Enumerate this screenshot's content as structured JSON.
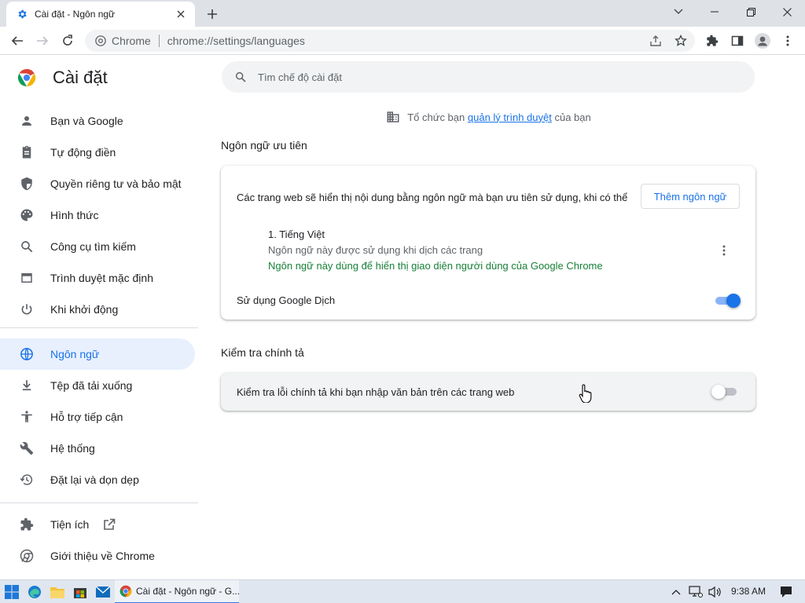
{
  "browser": {
    "tab_title": "Cài đặt - Ngôn ngữ",
    "omnibox_chip": "Chrome",
    "url": "chrome://settings/languages"
  },
  "sidebar": {
    "title": "Cài đặt",
    "items": [
      {
        "label": "Bạn và Google",
        "icon": "person-icon"
      },
      {
        "label": "Tự động điền",
        "icon": "clipboard-icon"
      },
      {
        "label": "Quyền riêng tư và bảo mật",
        "icon": "shield-icon"
      },
      {
        "label": "Hình thức",
        "icon": "palette-icon"
      },
      {
        "label": "Công cụ tìm kiếm",
        "icon": "search-icon"
      },
      {
        "label": "Trình duyệt mặc định",
        "icon": "browser-icon"
      },
      {
        "label": "Khi khởi động",
        "icon": "power-icon"
      },
      {
        "label": "Ngôn ngữ",
        "icon": "globe-icon",
        "active": true
      },
      {
        "label": "Tệp đã tải xuống",
        "icon": "download-icon"
      },
      {
        "label": "Hỗ trợ tiếp cận",
        "icon": "accessibility-icon"
      },
      {
        "label": "Hệ thống",
        "icon": "wrench-icon"
      },
      {
        "label": "Đặt lại và dọn dẹp",
        "icon": "restore-icon"
      },
      {
        "label": "Tiện ích",
        "icon": "puzzle-icon"
      },
      {
        "label": "Giới thiệu về Chrome",
        "icon": "chrome-icon"
      }
    ]
  },
  "main": {
    "search_placeholder": "Tìm chế độ cài đặt",
    "managed": {
      "prefix": "Tổ chức bạn",
      "link": "quản lý trình duyệt",
      "suffix": "của bạn"
    },
    "preferred_languages": {
      "title": "Ngôn ngữ ưu tiên",
      "description": "Các trang web sẽ hiển thị nội dung bằng ngôn ngữ mà bạn ưu tiên sử dụng, khi có thể",
      "add_button": "Thêm ngôn ngữ",
      "language_name": "1. Tiếng Việt",
      "language_note_1": "Ngôn ngữ này được sử dụng khi dịch các trang",
      "language_note_2": "Ngôn ngữ này dùng để hiển thị giao diện người dùng của Google Chrome",
      "translate_label": "Sử dụng Google Dịch",
      "translate_enabled": true
    },
    "spell_check": {
      "title": "Kiểm tra chính tả",
      "label": "Kiểm tra lỗi chính tả khi bạn nhập văn bản trên các trang web",
      "enabled": false
    }
  },
  "taskbar": {
    "active_app": "Cài đặt - Ngôn ngữ - G...",
    "time": "9:38 AM"
  },
  "colors": {
    "accent": "#1a73e8",
    "active_nav_bg": "#e8f0fe",
    "green_note": "#188038"
  }
}
